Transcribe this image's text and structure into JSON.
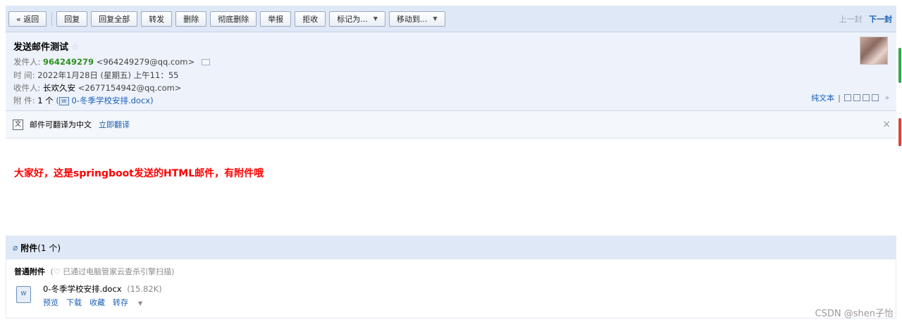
{
  "toolbar": {
    "back": "« 返回",
    "reply": "回复",
    "reply_all": "回复全部",
    "forward": "转发",
    "delete": "删除",
    "delete_perm": "彻底删除",
    "report": "举报",
    "reject": "拒收",
    "mark_as": "标记为...",
    "move_to": "移动到...",
    "prev": "上一封",
    "next": "下一封"
  },
  "mail": {
    "subject": "发送邮件测试",
    "star": "☆",
    "from_label": "发件人:",
    "from_name": "964249279",
    "from_email": "<964249279@qq.com>",
    "time_label": "时 间:",
    "time": "2022年1月28日 (星期五) 上午11：55",
    "to_label": "收件人:",
    "to_name": "长欢久安",
    "to_email": "<2677154942@qq.com>",
    "attach_label": "附 件:",
    "attach_count": "1 个",
    "attach_open": "(",
    "attach_file": "0-冬季学校安排.docx",
    "attach_close": ")",
    "view_plain": "纯文本",
    "view_sep": "|"
  },
  "translate": {
    "text": "邮件可翻译为中文",
    "link": "立即翻译",
    "close": "×"
  },
  "body": {
    "text": "大家好，这是springboot发送的HTML邮件，有附件哦"
  },
  "attachments": {
    "title": "附件",
    "count": "(1 个)",
    "normal_label": "普通附件",
    "scan_note": "(♡ 已通过电脑管家云查杀引擎扫描)",
    "file_name": "0-冬季学校安排.docx",
    "file_size": "(15.82K)",
    "actions": {
      "preview": "预览",
      "download": "下载",
      "collect": "收藏",
      "save_to": "转存"
    }
  },
  "watermark": "CSDN @shen子怡",
  "colors": {
    "toolbar_bg": "#dfe8f6",
    "header_bg": "#eef3fb",
    "link": "#1a5fb4",
    "sender": "#2f8f1e",
    "body_text": "#ff0000"
  }
}
